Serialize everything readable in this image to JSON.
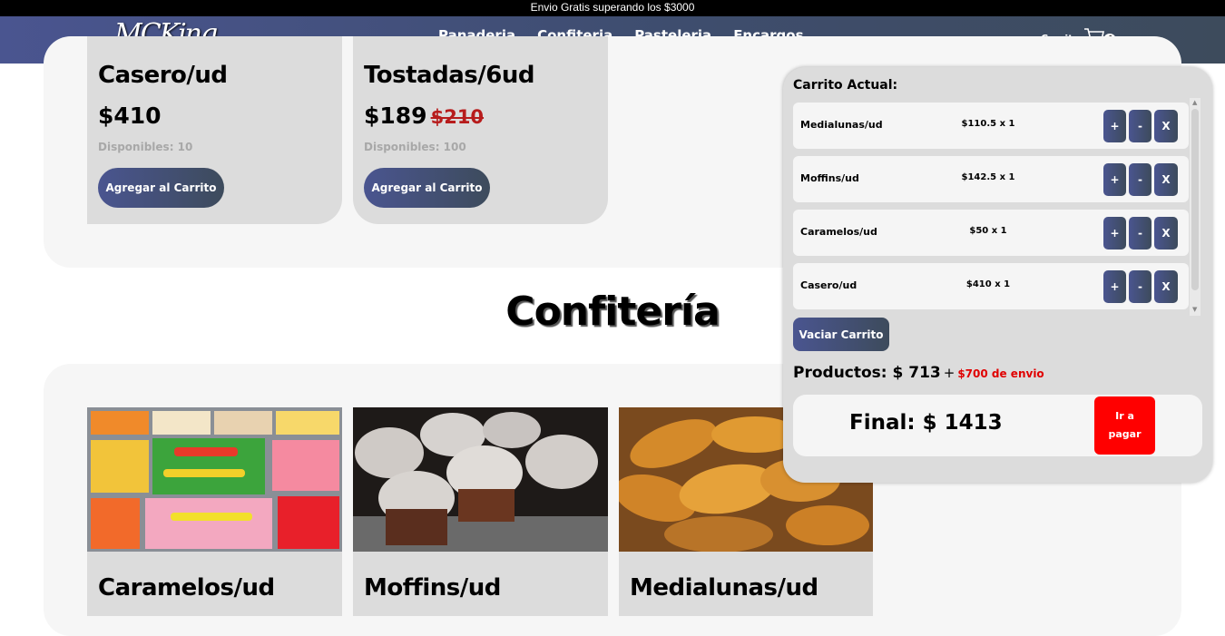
{
  "announcement": "Envio Gratis superando los $3000",
  "brand": {
    "logo_text": "MCKing"
  },
  "nav": {
    "items": [
      "Panaderia",
      "Confiteria",
      "Pasteleria",
      "Encargos"
    ]
  },
  "cart_link": {
    "label": "Carrito",
    "count": "4"
  },
  "bakery_section": {
    "products": [
      {
        "title": "Casero/ud",
        "price": "$410",
        "old_price": "",
        "stock": "Disponibles: 10",
        "button": "Agregar al Carrito"
      },
      {
        "title": "Tostadas/6ud",
        "price": "$189",
        "old_price": "$210",
        "stock": "Disponibles: 100",
        "button": "Agregar al Carrito"
      }
    ]
  },
  "confectionery_section": {
    "heading": "Confitería",
    "products": [
      {
        "title": "Caramelos/ud"
      },
      {
        "title": "Moffins/ud"
      },
      {
        "title": "Medialunas/ud"
      }
    ]
  },
  "cart_panel": {
    "heading": "Carrito Actual:",
    "items": [
      {
        "name": "Medialunas/ud",
        "price": "$110.5 x 1"
      },
      {
        "name": "Moffins/ud",
        "price": "$142.5 x 1"
      },
      {
        "name": "Caramelos/ud",
        "price": "$50 x 1"
      },
      {
        "name": "Casero/ud",
        "price": "$410 x 1"
      }
    ],
    "buttons": {
      "plus": "+",
      "minus": "-",
      "remove": "X"
    },
    "clear_label": "Vaciar Carrito",
    "products_label": "Productos: $ 713",
    "plus_sign": "+",
    "shipping_label": "$700 de envio",
    "final_label": "Final: $ 1413",
    "pay_label": "Ir a pagar"
  },
  "colors": {
    "accent_start": "#4a5590",
    "accent_end": "#3d4b5c",
    "pay": "#ff0000",
    "old_price": "#b71c1c"
  }
}
